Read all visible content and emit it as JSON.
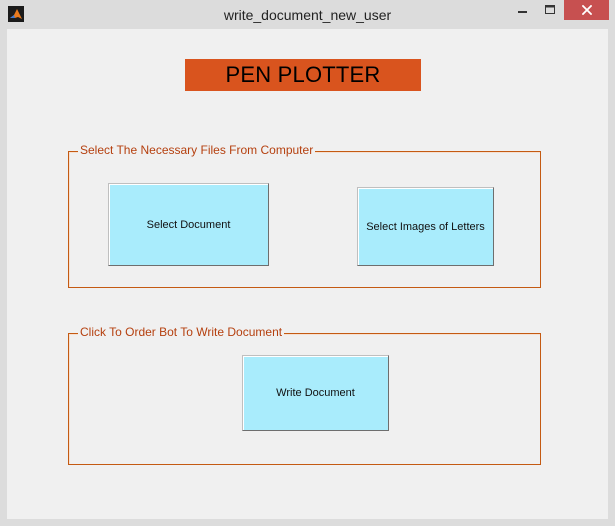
{
  "window": {
    "title": "write_document_new_user",
    "controls": {
      "minimize": "—",
      "maximize": "☐",
      "close": "✕"
    }
  },
  "main": {
    "heading": "PEN PLOTTER",
    "panels": [
      {
        "legend": "Select The Necessary Files From Computer",
        "buttons": [
          {
            "label": "Select Document"
          },
          {
            "label": "Select Images of Letters"
          }
        ]
      },
      {
        "legend": "Click To Order Bot To Write Document",
        "buttons": [
          {
            "label": "Write Document"
          }
        ]
      }
    ]
  },
  "colors": {
    "heading_bg": "#d9541e",
    "panel_border": "#c45a12",
    "legend_text": "#b5400f",
    "button_bg": "#a9ecfc",
    "close_button_bg": "#c75050"
  },
  "icons": {
    "app": "matlab-icon",
    "minimize": "minimize-icon",
    "maximize": "maximize-icon",
    "close": "close-icon"
  }
}
